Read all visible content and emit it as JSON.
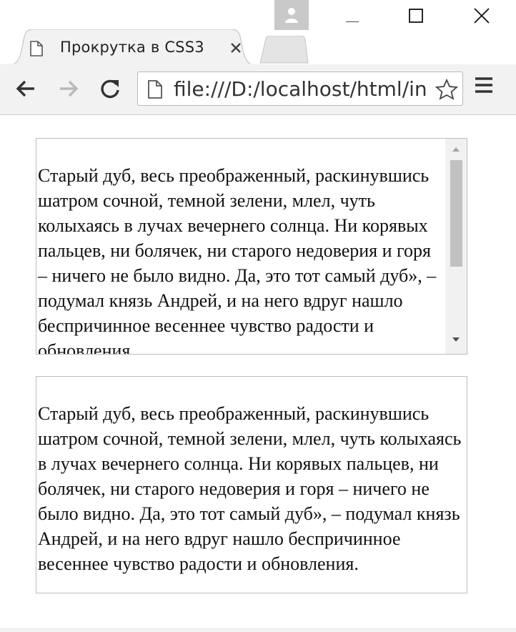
{
  "tab": {
    "title": "Прокрутка в CSS3"
  },
  "address_bar": {
    "url": "file:///D:/localhost/html/in"
  },
  "content": {
    "paragraph": "Старый дуб, весь преображенный, раскинувшись шатром сочной, темной зелени, млел, чуть колыхаясь в лучах вечернего солнца. Ни корявых пальцев, ни болячек, ни старого недоверия и горя – ничего не было видно. Да, это тот самый дуб», – подумал князь Андрей, и на него вдруг нашло беспричинное весеннее чувство радости и обновления.",
    "scrollbox1": {
      "scroll_position": 0.0,
      "visible_fraction": 0.62
    }
  },
  "colors": {
    "toolbar_bg": "#f2f2f2",
    "scrollbar_track": "#f1f1f1",
    "scrollbar_thumb": "#c1c1c1",
    "box_border": "#bdbdbd"
  },
  "icons": [
    "profile-icon",
    "minimize-icon",
    "maximize-icon",
    "close-icon",
    "page-icon",
    "tab-close-icon",
    "back-icon",
    "forward-icon",
    "reload-icon",
    "star-icon",
    "menu-icon",
    "scroll-up-icon",
    "scroll-down-icon"
  ]
}
